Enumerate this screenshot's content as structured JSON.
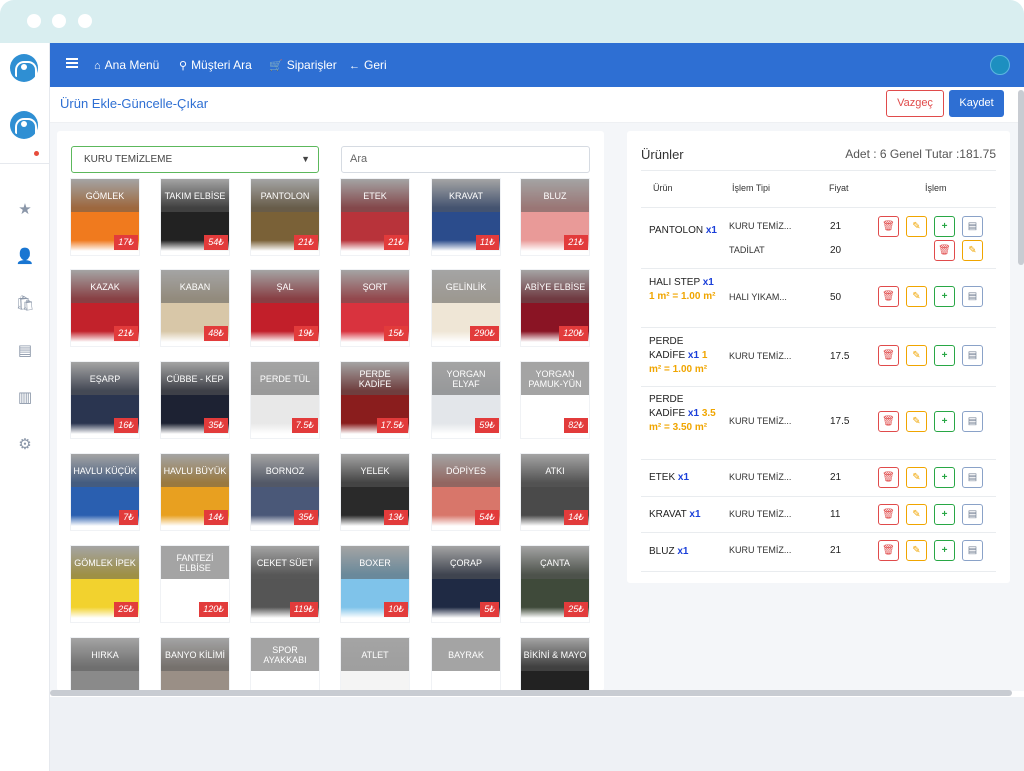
{
  "nav": {
    "items": [
      {
        "label": "Ana Menü",
        "icon": "home-icon",
        "glyph": "⌂"
      },
      {
        "label": "Müşteri Ara",
        "icon": "search-icon",
        "glyph": "⚲"
      },
      {
        "label": "Siparişler",
        "icon": "cart-icon",
        "glyph": "🛒"
      },
      {
        "label": "Geri",
        "icon": "arrow-left-icon",
        "glyph": "←"
      }
    ]
  },
  "sidebar": {
    "icons": [
      {
        "name": "star-icon",
        "glyph": "★"
      },
      {
        "name": "user-icon",
        "glyph": "👤"
      },
      {
        "name": "bag-icon",
        "glyph": "🛍"
      },
      {
        "name": "store-icon",
        "glyph": "▤"
      },
      {
        "name": "chart-icon",
        "glyph": "▥"
      },
      {
        "name": "gear-icon",
        "glyph": "⚙"
      }
    ]
  },
  "page": {
    "title": "Ürün Ekle-Güncelle-Çıkar",
    "cancel_label": "Vazgeç",
    "save_label": "Kaydet"
  },
  "filters": {
    "category_selected": "KURU TEMİZLEME",
    "search_placeholder": "Ara"
  },
  "product_tiles": [
    {
      "label": "GÖMLEK",
      "price": "17₺",
      "color": "#f07a1e"
    },
    {
      "label": "TAKIM ELBİSE",
      "price": "54₺",
      "color": "#222222"
    },
    {
      "label": "PANTOLON",
      "price": "21₺",
      "color": "#7a6137"
    },
    {
      "label": "ETEK",
      "price": "21₺",
      "color": "#b8333a"
    },
    {
      "label": "KRAVAT",
      "price": "11₺",
      "color": "#2b4c8c"
    },
    {
      "label": "BLUZ",
      "price": "21₺",
      "color": "#e99a98"
    },
    {
      "label": "KAZAK",
      "price": "21₺",
      "color": "#c2222b"
    },
    {
      "label": "KABAN",
      "price": "48₺",
      "color": "#d8c7a8"
    },
    {
      "label": "ŞAL",
      "price": "19₺",
      "color": "#c21f2a"
    },
    {
      "label": "ŞORT",
      "price": "15₺",
      "color": "#d9333e"
    },
    {
      "label": "GELİNLİK",
      "price": "290₺",
      "color": "#efe6d6"
    },
    {
      "label": "ABİYE ELBİSE",
      "price": "120₺",
      "color": "#8a1424"
    },
    {
      "label": "EŞARP",
      "price": "16₺",
      "color": "#2a3550"
    },
    {
      "label": "CÜBBE - KEP",
      "price": "35₺",
      "color": "#1d2233"
    },
    {
      "label": "PERDE TÜL",
      "price": "7.5₺",
      "color": "#e8e8e8"
    },
    {
      "label": "PERDE KADİFE",
      "price": "17.5₺",
      "color": "#8a1d1d"
    },
    {
      "label": "YORGAN ELYAF",
      "price": "59₺",
      "color": "#e3e6ea"
    },
    {
      "label": "YORGAN PAMUK-YÜN",
      "price": "82₺",
      "color": "#ffffff"
    },
    {
      "label": "HAVLU KÜÇÜK",
      "price": "7₺",
      "color": "#2a5fb0"
    },
    {
      "label": "HAVLU BÜYÜK",
      "price": "14₺",
      "color": "#e8a020"
    },
    {
      "label": "BORNOZ",
      "price": "35₺",
      "color": "#4a5878"
    },
    {
      "label": "YELEK",
      "price": "13₺",
      "color": "#2a2a2a"
    },
    {
      "label": "DÖPİYES",
      "price": "54₺",
      "color": "#d8766a"
    },
    {
      "label": "ATKI",
      "price": "14₺",
      "color": "#4a4a4a"
    },
    {
      "label": "GÖMLEK İPEK",
      "price": "25₺",
      "color": "#f2d22e"
    },
    {
      "label": "FANTEZİ ELBİSE",
      "price": "120₺",
      "color": "#ffffff"
    },
    {
      "label": "CEKET SÜET",
      "price": "119₺",
      "color": "#555555"
    },
    {
      "label": "BOXER",
      "price": "10₺",
      "color": "#7fc3ea"
    },
    {
      "label": "ÇORAP",
      "price": "5₺",
      "color": "#1f2a44"
    },
    {
      "label": "ÇANTA",
      "price": "25₺",
      "color": "#3f4a3a"
    },
    {
      "label": "HIRKA",
      "price": "",
      "color": "#8a8a8a"
    },
    {
      "label": "BANYO KİLİMİ",
      "price": "",
      "color": "#9a8f86"
    },
    {
      "label": "SPOR AYAKKABI",
      "price": "",
      "color": "#ffffff"
    },
    {
      "label": "ATLET",
      "price": "",
      "color": "#f4f4f4"
    },
    {
      "label": "BAYRAK",
      "price": "",
      "color": "#ffffff"
    },
    {
      "label": "BİKİNİ & MAYO",
      "price": "",
      "color": "#222222"
    }
  ],
  "products": {
    "title": "Ürünler",
    "summary": "Adet : 6 Genel Tutar :181.75",
    "headers": {
      "urun": "Ürün",
      "islem_tipi": "İşlem Tipi",
      "fiyat": "Fiyat",
      "islem": "İşlem"
    },
    "rows": [
      {
        "name": "PANTOLON",
        "qty": "x1",
        "dims": "",
        "type": "KURU TEMİZ...",
        "price": "21"
      },
      {
        "name": "HALI STEP",
        "qty": "x1",
        "dims": "1 m² = 1.00 m²",
        "type": "HALI YIKAM...",
        "price": "50"
      },
      {
        "name": "PERDE KADİFE",
        "qty": "x1",
        "dims": "1 m² = 1.00 m²",
        "type": "KURU TEMİZ...",
        "price": "17.5"
      },
      {
        "name": "PERDE KADİFE",
        "qty": "x1",
        "dims": "3.5 m² = 3.50 m²",
        "type": "KURU TEMİZ...",
        "price": "17.5"
      },
      {
        "name": "ETEK",
        "qty": "x1",
        "dims": "",
        "type": "KURU TEMİZ...",
        "price": "21"
      },
      {
        "name": "KRAVAT",
        "qty": "x1",
        "dims": "",
        "type": "KURU TEMİZ...",
        "price": "11"
      },
      {
        "name": "BLUZ",
        "qty": "x1",
        "dims": "",
        "type": "KURU TEMİZ...",
        "price": "21"
      }
    ],
    "sub_row": {
      "type": "TADİLAT",
      "price": "20"
    }
  },
  "action_icons": {
    "delete": "🗑",
    "edit": "✎",
    "add": "+",
    "note": "▤"
  }
}
